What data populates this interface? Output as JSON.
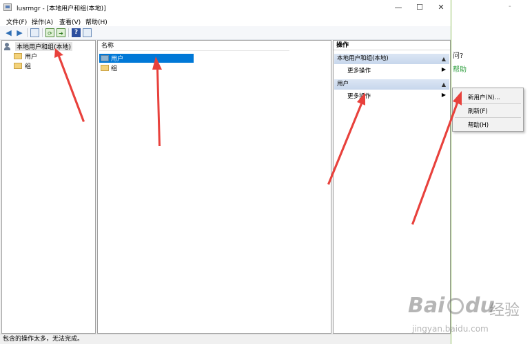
{
  "background": {
    "question_fragment": "问?",
    "link_fragment": "帮助",
    "dash": "-"
  },
  "window": {
    "title": "lusrmgr - [本地用户和组(本地)]",
    "buttons": {
      "minimize": "—",
      "maximize": "☐",
      "close": "✕"
    }
  },
  "menu": {
    "items": [
      "文件(F)",
      "操作(A)",
      "查看(V)",
      "帮助(H)"
    ]
  },
  "tree": {
    "root": "本地用户和组(本地)",
    "children": [
      "用户",
      "组"
    ]
  },
  "list": {
    "column_header": "名称",
    "rows": [
      "用户",
      "组"
    ]
  },
  "actions": {
    "title": "操作",
    "sections": [
      {
        "header": "本地用户和组(本地)",
        "item": "更多操作"
      },
      {
        "header": "用户",
        "item": "更多操作"
      }
    ]
  },
  "context_menu": {
    "items": [
      "新用户(N)...",
      "刷新(F)",
      "帮助(H)"
    ]
  },
  "status_bar": {
    "text": "包含的操作太多，无法完成。"
  },
  "watermark": {
    "brand": "Bai",
    "brand2": "du",
    "product": "经验",
    "url": "jingyan.baidu.com"
  },
  "colors": {
    "selection": "#0078d7",
    "section_header": "#c7d7ec",
    "annotation_arrow": "#e8413c",
    "window_border": "#8fbf5f"
  }
}
